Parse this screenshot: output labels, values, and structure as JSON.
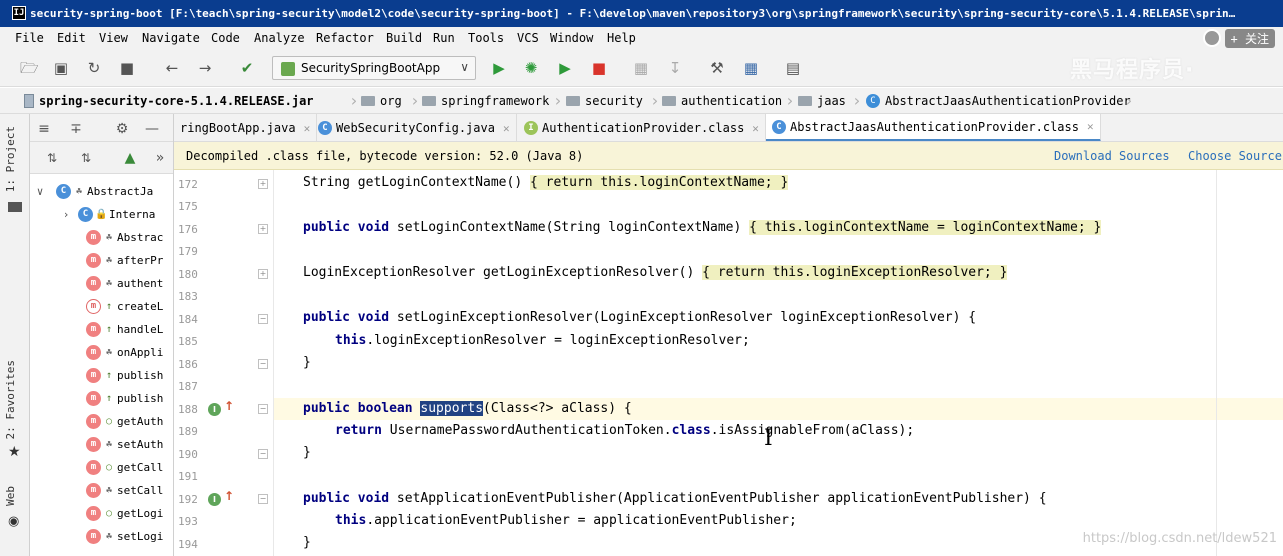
{
  "window": {
    "title": "security-spring-boot [F:\\teach\\spring-security\\model2\\code\\security-spring-boot] - F:\\develop\\maven\\repository3\\org\\springframework\\security\\spring-security-core\\5.1.4.RELEASE\\sprin…",
    "icon_label": "IJ"
  },
  "menu": {
    "items": [
      "File",
      "Edit",
      "View",
      "Navigate",
      "Code",
      "Analyze",
      "Refactor",
      "Build",
      "Run",
      "Tools",
      "VCS",
      "Window",
      "Help"
    ],
    "follow_label": "+ 关注"
  },
  "toolbar": {
    "run_config": "SecuritySpringBootApp",
    "watermark": "黑马程序员·"
  },
  "breadcrumb": {
    "items": [
      "spring-security-core-5.1.4.RELEASE.jar",
      "org",
      "springframework",
      "security",
      "authentication",
      "jaas",
      "AbstractJaasAuthenticationProvider"
    ]
  },
  "left_strip": {
    "tabs": [
      "1: Project",
      "2: Favorites",
      "Web"
    ]
  },
  "structure": {
    "root": "AbstractJa",
    "rows": [
      {
        "badge": "C",
        "vis": "lock",
        "label": "Interna",
        "arrow": "›"
      },
      {
        "badge": "m",
        "vis": "pkg",
        "label": "Abstrac"
      },
      {
        "badge": "m",
        "vis": "pkg",
        "label": "afterPr"
      },
      {
        "badge": "m",
        "vis": "pkg",
        "label": "authent"
      },
      {
        "badge": "m-abs",
        "vis": "prot",
        "label": "createL"
      },
      {
        "badge": "m",
        "vis": "prot",
        "label": "handleL"
      },
      {
        "badge": "m",
        "vis": "pkg",
        "label": "onAppli"
      },
      {
        "badge": "m",
        "vis": "prot",
        "label": "publish"
      },
      {
        "badge": "m",
        "vis": "prot",
        "label": "publish"
      },
      {
        "badge": "m",
        "vis": "dot",
        "label": "getAuth"
      },
      {
        "badge": "m",
        "vis": "pkg",
        "label": "setAuth"
      },
      {
        "badge": "m",
        "vis": "dot",
        "label": "getCall"
      },
      {
        "badge": "m",
        "vis": "pkg",
        "label": "setCall"
      },
      {
        "badge": "m",
        "vis": "dot",
        "label": "getLogi"
      },
      {
        "badge": "m",
        "vis": "pkg",
        "label": "setLogi"
      }
    ]
  },
  "tabs": [
    {
      "label": "ringBootApp.java",
      "icon": "",
      "active": false
    },
    {
      "label": "WebSecurityConfig.java",
      "icon": "C",
      "active": false
    },
    {
      "label": "AuthenticationProvider.class",
      "icon": "I",
      "active": false
    },
    {
      "label": "AbstractJaasAuthenticationProvider.class",
      "icon": "C",
      "active": true
    }
  ],
  "banner": {
    "message": "Decompiled .class file, bytecode version: 52.0 (Java 8)",
    "download": "Download Sources",
    "choose": "Choose Sources"
  },
  "editor": {
    "line_numbers": [
      "172",
      "175",
      "176",
      "179",
      "180",
      "183",
      "184",
      "185",
      "186",
      "187",
      "188",
      "189",
      "190",
      "191",
      "192",
      "193",
      "194"
    ],
    "lines": {
      "l172": "String getLoginContextName() ",
      "l172b": "{ return this.loginContextName; }",
      "l176a": "public void ",
      "l176b": "setLoginContextName(String loginContextName) ",
      "l176c": "{ this.loginContextName = loginContextName; }",
      "l180a": "LoginExceptionResolver getLoginExceptionResolver() ",
      "l180b": "{ return this.loginExceptionResolver; }",
      "l184a": "public void ",
      "l184b": "setLoginExceptionResolver(LoginExceptionResolver loginExceptionResolver) {",
      "l185a": "this",
      "l185b": ".loginExceptionResolver = loginExceptionResolver;",
      "l186": "}",
      "l188a": "public boolean ",
      "l188b": "supports",
      "l188c": "(Class<?> aClass) {",
      "l189a": "return ",
      "l189b": "UsernamePasswordAuthenticationToken.",
      "l189c": "class",
      "l189d": ".isAssignableFrom(aClass);",
      "l190": "}",
      "l192a": "public void ",
      "l192b": "setApplicationEventPublisher(ApplicationEventPublisher applicationEventPublisher) {",
      "l193a": "this",
      "l193b": ".applicationEventPublisher = applicationEventPublisher;",
      "l194": "}"
    },
    "watermark": "https://blog.csdn.net/ldew521"
  },
  "colors": {
    "titlebar": "#0a3d8f",
    "keyword": "#000080",
    "selection": "#214283",
    "banner_bg": "#f8f4d8",
    "link": "#2a6ebb"
  }
}
